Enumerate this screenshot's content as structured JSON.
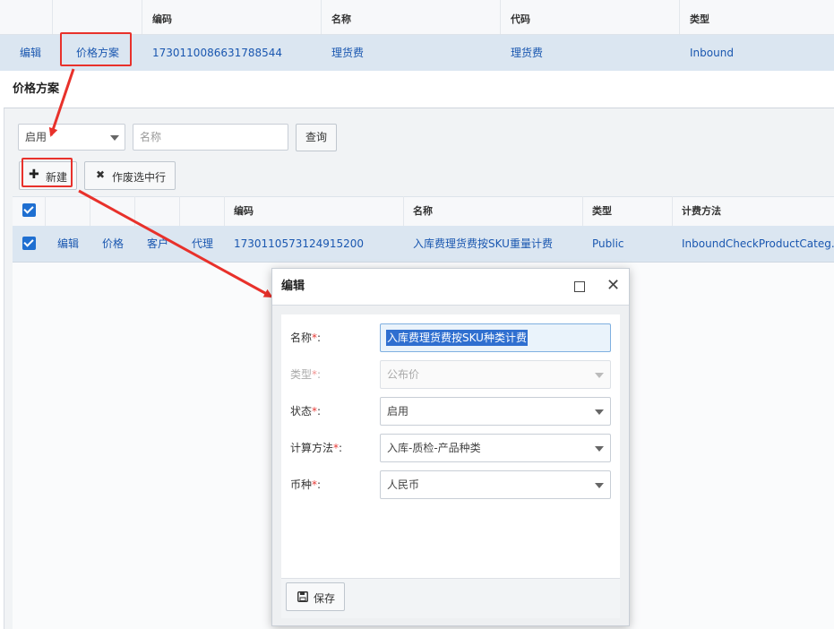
{
  "bg_grid": {
    "headers": [
      "编码",
      "名称",
      "代码",
      "类型"
    ],
    "row": {
      "edit": "编辑",
      "price_plan": "价格方案",
      "code": "1730110086631788544",
      "name": "理货费",
      "short_code": "理货费",
      "type": "Inbound"
    }
  },
  "panel": {
    "title": "价格方案",
    "status_filter": "启用",
    "name_placeholder": "名称",
    "query_label": "查询",
    "new_label": "新建",
    "void_label": "作废选中行",
    "grid_headers": [
      "编码",
      "名称",
      "类型",
      "计费方法"
    ],
    "row": {
      "edit": "编辑",
      "price": "价格",
      "customer": "客户",
      "agent": "代理",
      "code": "1730110573124915200",
      "name": "入库费理货费按SKU重量计费",
      "type": "Public",
      "method": "InboundCheckProductCateg..."
    }
  },
  "dialog": {
    "title": "编辑",
    "fields": [
      {
        "label": "名称",
        "value": "入库费理货费按SKU种类计费"
      },
      {
        "label": "类型",
        "value": "公布价"
      },
      {
        "label": "状态",
        "value": "启用"
      },
      {
        "label": "计算方法",
        "value": "入库-质检-产品种类"
      },
      {
        "label": "币种",
        "value": "人民币"
      }
    ],
    "required_mark": "*",
    "colon": ":",
    "save_label": "保存"
  },
  "colors": {
    "link": "#1a57b0",
    "selected_row": "#dbe6f1",
    "annotation_red": "#e8312b",
    "checkbox": "#1f6fd1"
  }
}
